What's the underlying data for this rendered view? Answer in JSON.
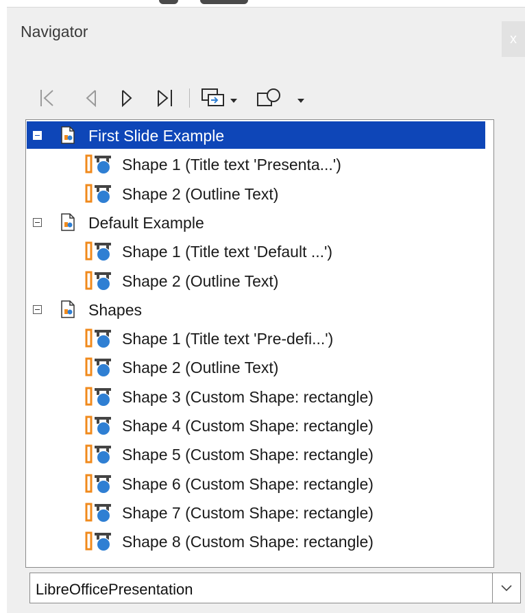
{
  "window": {
    "title": "Navigator",
    "close_label": "x"
  },
  "toolbar": {
    "buttons": [
      {
        "name": "first-slide",
        "icon": "first-icon"
      },
      {
        "name": "previous-slide",
        "icon": "previous-icon"
      },
      {
        "name": "next-slide",
        "icon": "next-icon"
      },
      {
        "name": "last-slide",
        "icon": "last-icon"
      },
      {
        "name": "drag-mode",
        "icon": "drag-mode-icon"
      },
      {
        "name": "shapes",
        "icon": "shapes-icon"
      }
    ]
  },
  "tree": {
    "slides": [
      {
        "label": "First Slide Example",
        "selected": true,
        "shapes": [
          "Shape 1 (Title text 'Presenta...')",
          "Shape 2 (Outline Text)"
        ]
      },
      {
        "label": "Default Example",
        "selected": false,
        "shapes": [
          "Shape 1 (Title text 'Default ...')",
          "Shape 2 (Outline Text)"
        ]
      },
      {
        "label": "Shapes",
        "selected": false,
        "shapes": [
          "Shape 1 (Title text 'Pre-defi...')",
          "Shape 2 (Outline Text)",
          "Shape 3 (Custom Shape: rectangle)",
          "Shape 4 (Custom Shape: rectangle)",
          "Shape 5 (Custom Shape: rectangle)",
          "Shape 6 (Custom Shape: rectangle)",
          "Shape 7 (Custom Shape: rectangle)",
          "Shape 8 (Custom Shape: rectangle)"
        ]
      }
    ]
  },
  "document_select": {
    "value": "LibreOfficePresentation"
  },
  "colors": {
    "selection": "#0e46b8",
    "shape_orange": "#f08a1c",
    "shape_blue": "#2f7fd3"
  }
}
